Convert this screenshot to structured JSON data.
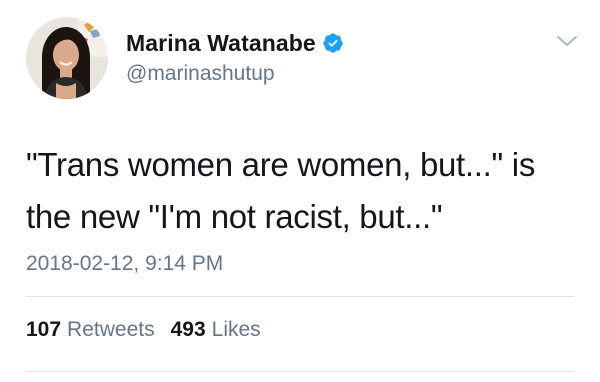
{
  "user": {
    "display_name": "Marina Watanabe",
    "handle": "@marinashutup",
    "verified_icon": "verified-badge-icon",
    "verified_color": "#1da1f2"
  },
  "tweet": {
    "text_lines": [
      "\"Trans women are women, but...\" is",
      "the new \"I'm not racist, but...\""
    ],
    "timestamp": "2018-02-12, 9:14 PM"
  },
  "stats": {
    "retweets_count": "107",
    "retweets_label": "Retweets",
    "likes_count": "493",
    "likes_label": "Likes"
  },
  "menu": {
    "icon": "chevron-down-icon"
  },
  "colors": {
    "text_primary": "#14171a",
    "text_secondary": "#657786",
    "divider": "#e1e8ed"
  }
}
